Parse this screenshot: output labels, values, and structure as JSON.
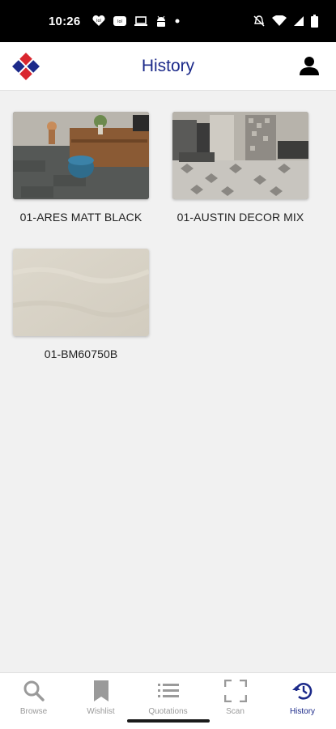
{
  "status_bar": {
    "time": "10:26",
    "left_icons": [
      "fb-messenger-icon",
      "lol-icon",
      "lol-icon",
      "laptop-icon",
      "android-icon",
      "dot-icon"
    ],
    "right_icons": [
      "mute-icon",
      "wifi-icon",
      "signal-icon",
      "battery-icon"
    ]
  },
  "app_bar": {
    "title": "History",
    "logo": "brand-logo-icon",
    "profile_icon": "person-icon"
  },
  "history": {
    "items": [
      {
        "label": "01-ARES MATT BLACK",
        "image": "living-room-tile-photo"
      },
      {
        "label": "01-AUSTIN DECOR MIX",
        "image": "kitchen-tile-photo"
      },
      {
        "label": "01-BM60750B",
        "image": "beige-tile-swatch"
      }
    ]
  },
  "bottom_nav": {
    "active": "History",
    "items": [
      {
        "label": "Browse",
        "icon": "search-icon"
      },
      {
        "label": "Wishlist",
        "icon": "bookmark-icon"
      },
      {
        "label": "Quotations",
        "icon": "list-icon"
      },
      {
        "label": "Scan",
        "icon": "scan-icon"
      },
      {
        "label": "History",
        "icon": "history-icon"
      }
    ]
  },
  "colors": {
    "brand_blue": "#1c2a8a",
    "brand_red": "#d9262e",
    "inactive_nav": "#9a9a9a",
    "background": "#f1f1f1"
  }
}
